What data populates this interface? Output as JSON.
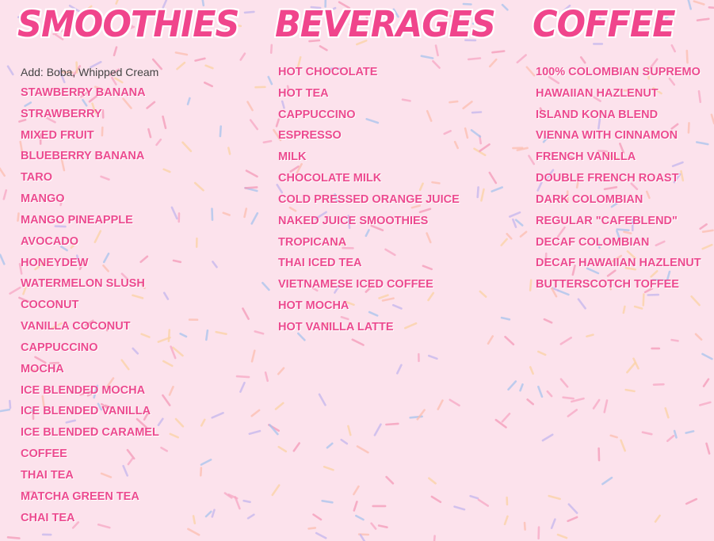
{
  "theme": {
    "background": "#fce2ec",
    "heading_color": "#f0458c",
    "item_color": "#ec4a8f",
    "note_color": "#444444",
    "sprinkle_colors": [
      "#f7a8c4",
      "#a9c4ee",
      "#fbd3a5",
      "#f49ab8",
      "#c5b6ee",
      "#fdbfb0"
    ]
  },
  "smoothies": {
    "title": "SMOOTHIES",
    "note": "Add: Boba, Whipped Cream",
    "items": [
      "STAWBERRY BANANA",
      "STRAWBERRY",
      "MIXED FRUIT",
      "BLUEBERRY BANANA",
      "TARO",
      "MANGO",
      "MANGO PINEAPPLE",
      "AVOCADO",
      "HONEYDEW",
      "WATERMELON SLUSH",
      "COCONUT",
      "VANILLA COCONUT",
      "CAPPUCCINO",
      "MOCHA",
      "ICE BLENDED MOCHA",
      "ICE BLENDED VANILLA",
      "ICE BLENDED CARAMEL",
      "COFFEE",
      "THAI TEA",
      "MATCHA GREEN TEA",
      "CHAI TEA"
    ]
  },
  "beverages": {
    "title": "BEVERAGES",
    "items": [
      "HOT CHOCOLATE",
      "HOT TEA",
      "CAPPUCCINO",
      "ESPRESSO",
      "MILK",
      "CHOCOLATE MILK",
      "COLD PRESSED ORANGE JUICE",
      "NAKED JUICE SMOOTHIES",
      "TROPICANA",
      "THAI ICED TEA",
      "VIETNAMESE ICED COFFEE",
      "HOT MOCHA",
      "HOT VANILLA LATTE"
    ]
  },
  "coffee": {
    "title": "COFFEE",
    "items": [
      "100% COLOMBIAN SUPREMO",
      "HAWAIIAN HAZLENUT",
      "ISLAND KONA BLEND",
      "VIENNA WITH CINNAMON",
      "FRENCH VANILLA",
      "DOUBLE FRENCH ROAST",
      "DARK COLOMBIAN",
      "REGULAR \"CAFEBLEND\"",
      "DECAF COLOMBIAN",
      "DECAF HAWAIIAN HAZLENUT",
      "BUTTERSCOTCH TOFFEE"
    ]
  }
}
